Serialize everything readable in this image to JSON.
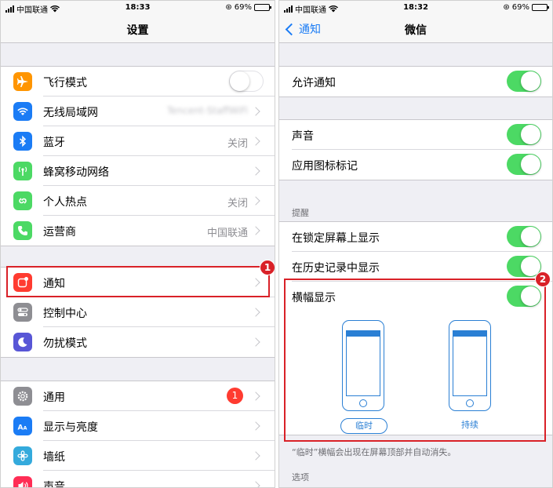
{
  "colors": {
    "accent": "#1b7cf5",
    "toggle_on": "#4cd964",
    "badge_red": "#ff3b30",
    "highlight_red": "#d92128"
  },
  "left": {
    "status": {
      "carrier": "中国联通",
      "time": "18:33",
      "battery": "69%",
      "battery_level": 0.69
    },
    "nav": {
      "title": "设置"
    },
    "group1": [
      {
        "label": "飞行模式",
        "icon": "airplane-icon",
        "icon_color": "#ff9500",
        "control": "toggle-off"
      },
      {
        "label": "无线局域网",
        "icon": "wifi-icon",
        "icon_color": "#1b7cf5",
        "value": "Tencent-StaffWiFi"
      },
      {
        "label": "蓝牙",
        "icon": "bluetooth-icon",
        "icon_color": "#1b7cf5",
        "value": "关闭"
      },
      {
        "label": "蜂窝移动网络",
        "icon": "cellular-icon",
        "icon_color": "#4cd964"
      },
      {
        "label": "个人热点",
        "icon": "hotspot-icon",
        "icon_color": "#4cd964",
        "value": "关闭"
      },
      {
        "label": "运营商",
        "icon": "phone-icon",
        "icon_color": "#4cd964",
        "value": "中国联通"
      }
    ],
    "group2": [
      {
        "label": "通知",
        "icon": "notifications-icon",
        "icon_color": "#ff3b30"
      },
      {
        "label": "控制中心",
        "icon": "control-center-icon",
        "icon_color": "#8e8e93"
      },
      {
        "label": "勿扰模式",
        "icon": "moon-icon",
        "icon_color": "#5856d6"
      }
    ],
    "group3": [
      {
        "label": "通用",
        "icon": "gear-icon",
        "icon_color": "#8e8e93",
        "badge": "1"
      },
      {
        "label": "显示与亮度",
        "icon": "display-icon",
        "icon_color": "#1b7cf5"
      },
      {
        "label": "墙纸",
        "icon": "wallpaper-icon",
        "icon_color": "#34aadc"
      },
      {
        "label": "声音",
        "icon": "sound-icon",
        "icon_color": "#ff2d55"
      }
    ],
    "marker": "1"
  },
  "right": {
    "status": {
      "carrier": "中国联通",
      "time": "18:32",
      "battery": "69%",
      "battery_level": 0.69
    },
    "nav": {
      "back_label": "通知",
      "title": "微信"
    },
    "allow": {
      "label": "允许通知",
      "on": true
    },
    "group_sound": [
      {
        "label": "声音",
        "on": true
      },
      {
        "label": "应用图标标记",
        "on": true
      }
    ],
    "alerts_header": "提醒",
    "group_alerts": [
      {
        "label": "在锁定屏幕上显示",
        "on": true
      },
      {
        "label": "在历史记录中显示",
        "on": true
      },
      {
        "label": "横幅显示",
        "on": true
      }
    ],
    "banner_styles": [
      {
        "label": "临时",
        "selected": true
      },
      {
        "label": "持续",
        "selected": false
      }
    ],
    "footnote": "“临时”横幅会出现在屏幕顶部并自动消失。",
    "options_header": "选项",
    "marker": "2"
  }
}
